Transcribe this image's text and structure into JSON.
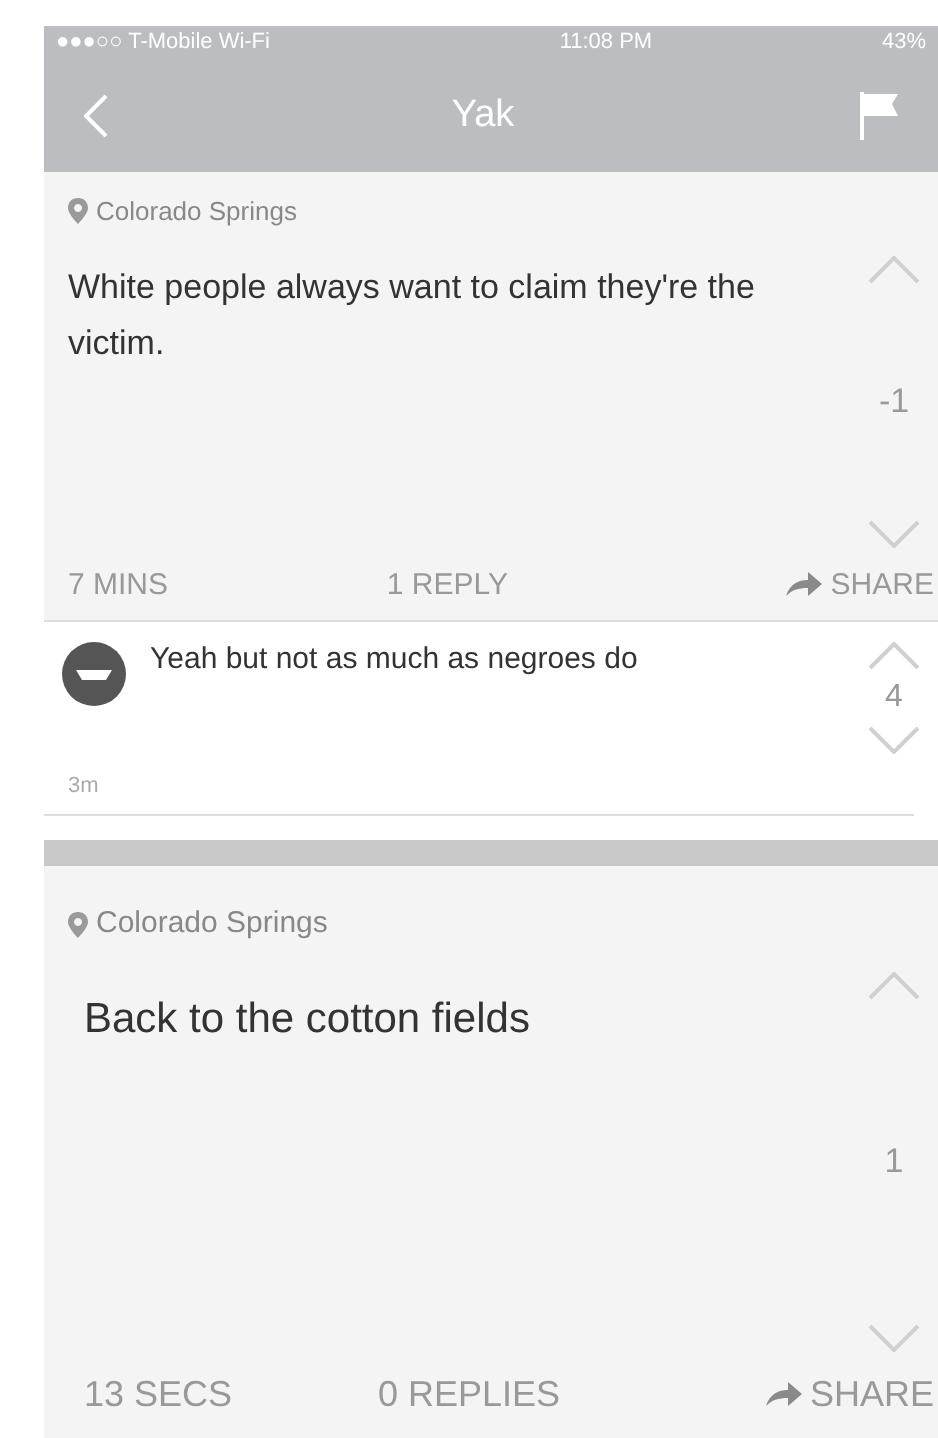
{
  "status_bar": {
    "carrier": "●●●○○ T-Mobile Wi-Fi",
    "time": "11:08 PM",
    "battery": "43%"
  },
  "nav": {
    "title": "Yak"
  },
  "posts": [
    {
      "location": "Colorado Springs",
      "text": "White people always want to claim they're the victim.",
      "score": "-1",
      "time": "7 MINS",
      "replies": "1 REPLY",
      "share": "SHARE",
      "comments": [
        {
          "text": "Yeah but not as much as negroes do",
          "score": "4",
          "time": "3m"
        }
      ]
    },
    {
      "location": "Colorado Springs",
      "text": "Back to the cotton fields",
      "score": "1",
      "time": "13 SECS",
      "replies": "0 REPLIES",
      "share": "SHARE"
    }
  ]
}
